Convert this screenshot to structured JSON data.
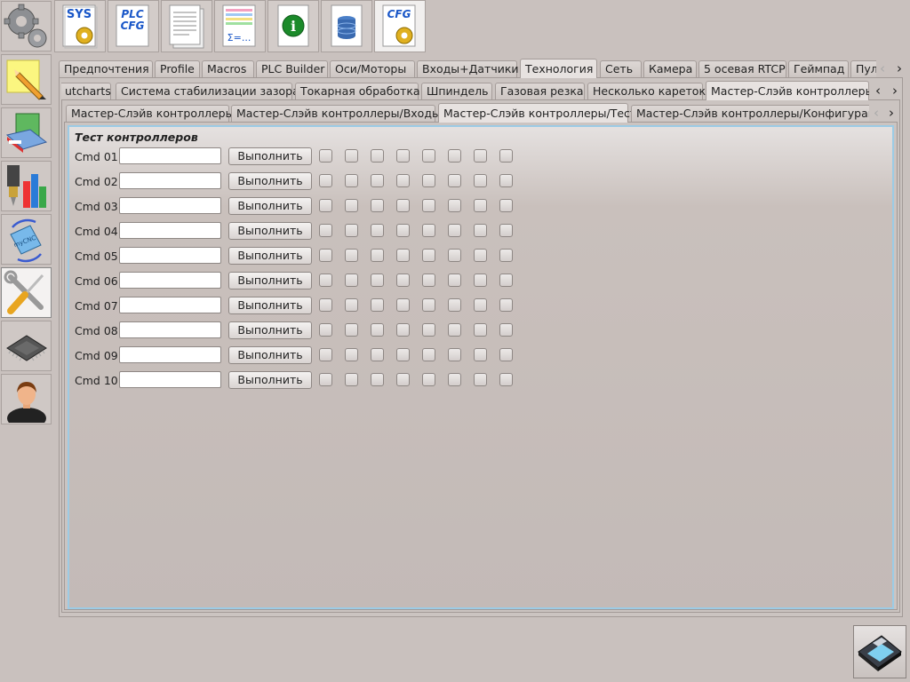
{
  "toolbar": {
    "buttons": [
      {
        "name": "sys",
        "label": "SYS"
      },
      {
        "name": "plc-cfg",
        "label1": "PLC",
        "label2": "CFG"
      },
      {
        "name": "document"
      },
      {
        "name": "formula",
        "label": "Σ=..."
      },
      {
        "name": "info",
        "label": "i"
      },
      {
        "name": "database"
      },
      {
        "name": "cfg",
        "label": "CFG"
      }
    ]
  },
  "tabs_level1": [
    "Предпочтения",
    "Profile",
    "Macros",
    "PLC Builder",
    "Оси/Моторы",
    "Входы+Датчики",
    "Технология",
    "Сеть",
    "Камера",
    "5 осевая RTCP",
    "Геймпад",
    "Пул"
  ],
  "tabs_level2": [
    "utcharts",
    "Система стабилизации зазора",
    "Токарная обработка",
    "Шпиндель",
    "Газовая резка",
    "Несколько кареток",
    "Мастер-Слэйв контроллеры"
  ],
  "tabs_level3": [
    "Мастер-Слэйв контроллеры",
    "Мастер-Слэйв контроллеры/Входы",
    "Мастер-Слэйв контроллеры/Тест",
    "Мастер-Слэйв контроллеры/Конфигурация"
  ],
  "arrows": {
    "left": "‹",
    "right": "›"
  },
  "group": {
    "title": "Тест контроллеров",
    "button_label": "Выполнить",
    "rows": [
      {
        "label": "Cmd 01",
        "value": ""
      },
      {
        "label": "Cmd 02",
        "value": ""
      },
      {
        "label": "Cmd 03",
        "value": ""
      },
      {
        "label": "Cmd 04",
        "value": ""
      },
      {
        "label": "Cmd 05",
        "value": ""
      },
      {
        "label": "Cmd 06",
        "value": ""
      },
      {
        "label": "Cmd 07",
        "value": ""
      },
      {
        "label": "Cmd 08",
        "value": ""
      },
      {
        "label": "Cmd 09",
        "value": ""
      },
      {
        "label": "Cmd 10",
        "value": ""
      }
    ]
  },
  "sidebar": {
    "items": [
      {
        "name": "settings-gears-icon"
      },
      {
        "name": "notepad-pencil-icon"
      },
      {
        "name": "books-icon"
      },
      {
        "name": "tool-chart-icon"
      },
      {
        "name": "mycnc-rotate-icon",
        "label": "myCNC"
      },
      {
        "name": "wrench-screwdriver-icon"
      },
      {
        "name": "microchip-icon"
      },
      {
        "name": "user-icon"
      }
    ]
  }
}
